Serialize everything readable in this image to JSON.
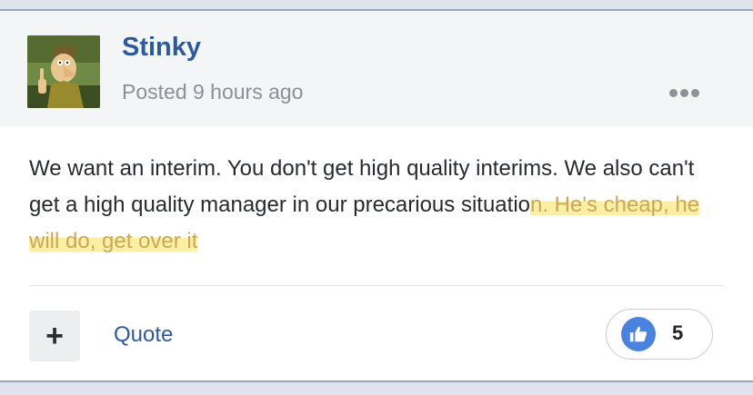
{
  "post": {
    "author": "Stinky",
    "posted_label": "Posted 9 hours ago",
    "body_plain": "We want an interim. You don't get high quality interims. We also can't get a high quality manager in our precarious situatio",
    "body_highlighted": "n. He's cheap, he will do, get over it",
    "reaction_count": "5",
    "reaction_icon": "thumbs-up-icon",
    "menu_icon": "ellipsis-icon"
  },
  "actions": {
    "add_icon_text": "+",
    "quote_label": "Quote"
  },
  "colors": {
    "author": "#2f5a9a",
    "highlight": "#fbeea5",
    "like_badge": "#4a82e0"
  }
}
